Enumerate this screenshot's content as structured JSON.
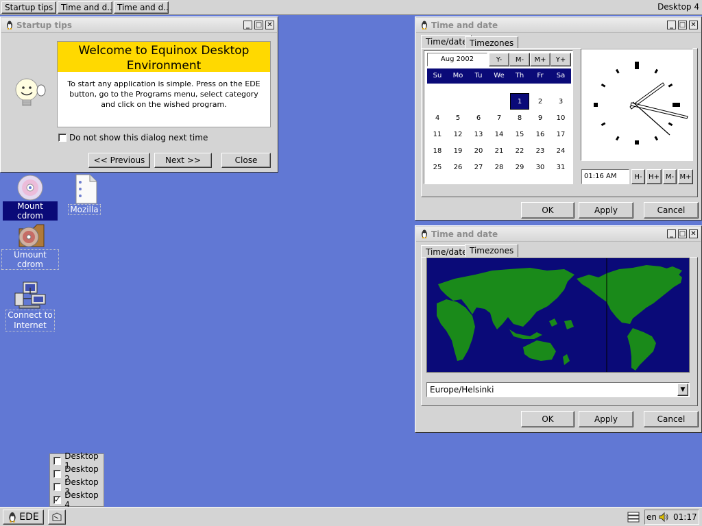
{
  "taskbar": {
    "tasks": [
      "Startup tips",
      "Time and d...",
      "Time and d..."
    ],
    "desktop_label": "Desktop 4"
  },
  "startup": {
    "title": "Startup tips",
    "heading": "Welcome to Equinox Desktop Environment",
    "body": "To start any application is simple. Press on the EDE button, go to the Programs menu, select category and click on the wished program.",
    "checkbox_label": "Do not show this dialog next time",
    "prev": "<< Previous",
    "next": "Next >>",
    "close": "Close"
  },
  "window_buttons": {
    "minimize": "_",
    "maximize": "□",
    "close": "✕"
  },
  "timedate1": {
    "title": "Time and date",
    "tabs": [
      "Time/date",
      "Timezones"
    ],
    "month_value": "Aug 2002",
    "nav_buttons": [
      "Y-",
      "M-",
      "M+",
      "Y+"
    ],
    "weekdays": [
      "Su",
      "Mo",
      "Tu",
      "We",
      "Th",
      "Fr",
      "Sa"
    ],
    "days": [
      "",
      "",
      "",
      "",
      "1",
      "2",
      "3",
      "4",
      "5",
      "6",
      "7",
      "8",
      "9",
      "10",
      "11",
      "12",
      "13",
      "14",
      "15",
      "16",
      "17",
      "18",
      "19",
      "20",
      "21",
      "22",
      "23",
      "24",
      "25",
      "26",
      "27",
      "28",
      "29",
      "30",
      "31"
    ],
    "selected_day": "1",
    "time_value": "01:16 AM",
    "time_buttons": [
      "H-",
      "H+",
      "M-",
      "M+"
    ],
    "ok": "OK",
    "apply": "Apply",
    "cancel": "Cancel"
  },
  "timedate2": {
    "title": "Time and date",
    "tabs": [
      "Time/date",
      "Timezones"
    ],
    "timezone": "Europe/Helsinki",
    "ok": "OK",
    "apply": "Apply",
    "cancel": "Cancel"
  },
  "desktop_icons": [
    {
      "label": "Mount cdrom",
      "icon": "cdrom-icon"
    },
    {
      "label": "Mozilla",
      "icon": "document-icon"
    },
    {
      "label": "Umount cdrom",
      "icon": "cdrom-umount-icon"
    },
    {
      "label1": "Connect to",
      "label2": "Internet",
      "icon": "network-icon"
    }
  ],
  "pager": {
    "desktops": [
      {
        "label": "Desktop 1",
        "checked": false
      },
      {
        "label": "Desktop 2",
        "checked": false
      },
      {
        "label": "Desktop 3",
        "checked": false
      },
      {
        "label": "Desktop 4",
        "checked": true
      }
    ],
    "check_mark": "✓"
  },
  "bottombar": {
    "ede_label": "EDE",
    "lang": "en",
    "clock": "01:17"
  },
  "colors": {
    "desktop": "#6178d4",
    "selection": "#0a0a78",
    "welcome_header": "#ffd900",
    "map_ocean": "#0a0a78",
    "map_land": "#1a8a1a"
  }
}
